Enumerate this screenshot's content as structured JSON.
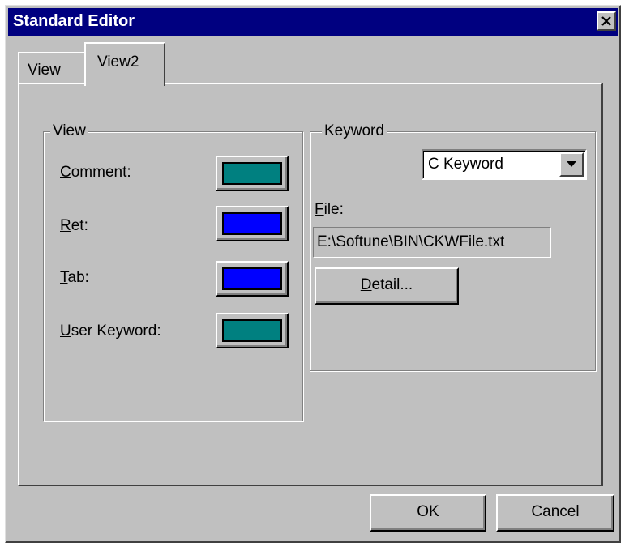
{
  "window": {
    "title": "Standard Editor"
  },
  "tabs": [
    {
      "label": "View",
      "active": false
    },
    {
      "label": "View2",
      "active": true
    }
  ],
  "view_group": {
    "label": "View",
    "items": [
      {
        "label_accel": "C",
        "label_rest": "omment:",
        "color": "#008080"
      },
      {
        "label_accel": "R",
        "label_rest": "et:",
        "color": "#0000ff"
      },
      {
        "label_accel": "T",
        "label_rest": "ab:",
        "color": "#0000ff"
      },
      {
        "label_accel": "U",
        "label_rest": "ser Keyword:",
        "color": "#008080"
      }
    ]
  },
  "keyword_group": {
    "label": "Keyword",
    "combo_value": "C Keyword",
    "file_label_accel": "F",
    "file_label_rest": "ile:",
    "file_path": "E:\\Softune\\BIN\\CKWFile.txt",
    "detail_accel": "D",
    "detail_rest": "etail..."
  },
  "buttons": {
    "ok": "OK",
    "cancel": "Cancel"
  },
  "icons": {
    "close": "close-icon",
    "dropdown": "chevron-down-icon"
  }
}
